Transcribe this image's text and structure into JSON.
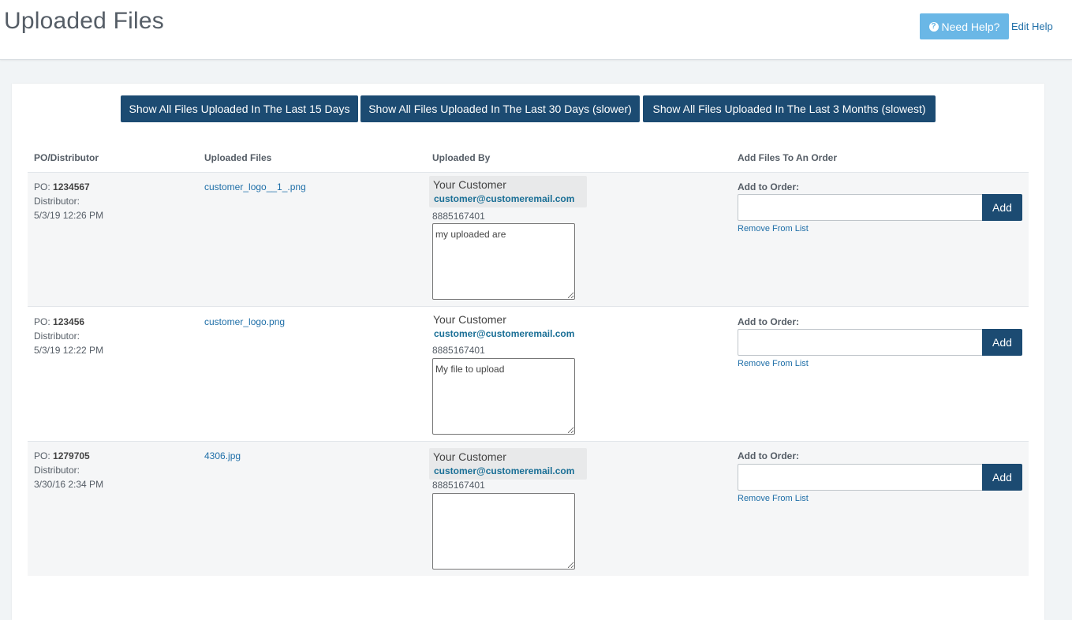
{
  "header": {
    "title": "Uploaded Files",
    "help_button_label": "Need Help?",
    "edit_help_label": "Edit Help"
  },
  "filters": [
    {
      "label": "Show All Files Uploaded In The Last 15 Days"
    },
    {
      "label": "Show All Files Uploaded In The Last 30 Days (slower)"
    },
    {
      "label": "Show All Files Uploaded In The Last 3 Months (slowest)"
    }
  ],
  "table": {
    "columns": [
      "PO/Distributor",
      "Uploaded Files",
      "Uploaded By",
      "Add Files To An Order"
    ],
    "po_prefix": "PO:",
    "distributor_label": "Distributor:",
    "add_to_order_label": "Add to Order:",
    "add_button_label": "Add",
    "remove_label": "Remove From List",
    "rows": [
      {
        "po": "1234567",
        "date": "5/3/19 12:26 PM",
        "file": "customer_logo__1_.png",
        "user_name": "Your Customer",
        "user_email": "customer@customeremail.com",
        "user_phone": "8885167401",
        "note": "my uploaded are",
        "order_value": ""
      },
      {
        "po": "123456",
        "date": "5/3/19 12:22 PM",
        "file": "customer_logo.png",
        "user_name": "Your Customer",
        "user_email": "customer@customeremail.com",
        "user_phone": "8885167401",
        "note": "My file to upload",
        "order_value": ""
      },
      {
        "po": "1279705",
        "date": "3/30/16 2:34 PM",
        "file": "4306.jpg",
        "user_name": "Your Customer",
        "user_email": "customer@customeremail.com",
        "user_phone": "8885167401",
        "note": "",
        "order_value": ""
      }
    ]
  }
}
